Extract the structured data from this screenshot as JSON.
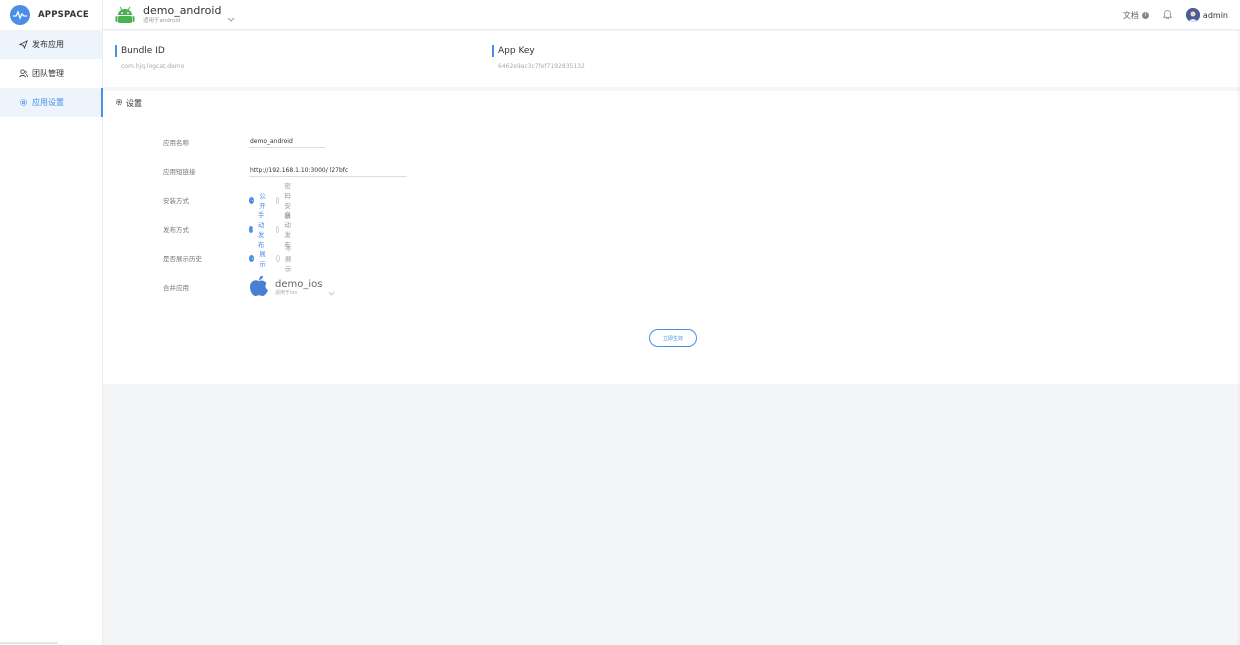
{
  "brand": {
    "name": "APPSPACE",
    "accent": "#4a8fe7"
  },
  "sidebar": {
    "items": [
      {
        "label": "发布应用",
        "icon": "send-icon"
      },
      {
        "label": "团队管理",
        "icon": "team-icon"
      },
      {
        "label": "应用设置",
        "icon": "gear-icon",
        "active": true
      }
    ]
  },
  "header": {
    "app_name": "demo_android",
    "app_platform": "适用于android",
    "app_icon": "android-icon",
    "docs_label": "文档",
    "user_name": "admin"
  },
  "keys": {
    "bundle_label": "Bundle ID",
    "bundle_value": "com.hjq.logcat.demo",
    "appkey_label": "App Key",
    "appkey_value": "6462e9ac3c7fef7192835132"
  },
  "settings": {
    "title": "设置",
    "fields": {
      "name_label": "应用名称",
      "name_value": "demo_android",
      "link_label": "应用短链接",
      "link_value": "http://192.168.1.10:3000/ l27bfc",
      "install_label": "安装方式",
      "install_options": [
        "公开",
        "密码安装"
      ],
      "install_selected": "公开",
      "publish_label": "发布方式",
      "publish_options": [
        "手动发布",
        "自动发布"
      ],
      "publish_selected": "手动发布",
      "history_label": "是否展示历史",
      "history_options": [
        "展示",
        "不展示"
      ],
      "history_selected": "展示",
      "merge_label": "合并应用",
      "merge_app_name": "demo_ios",
      "merge_app_platform": "适用于ios",
      "merge_app_icon": "apple-icon"
    },
    "apply_label": "立即生效"
  }
}
